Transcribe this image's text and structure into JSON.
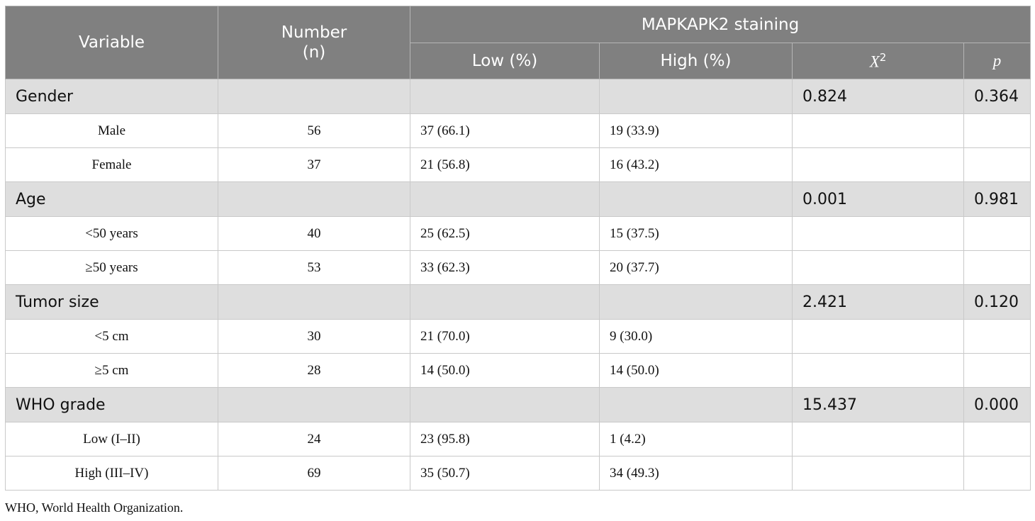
{
  "header": {
    "variable": "Variable",
    "number_line1": "Number",
    "number_line2": "(n)",
    "group": "MAPKAPK2 staining",
    "low": "Low (%)",
    "high": "High (%)",
    "chi_base": "X",
    "chi_sup": "2",
    "p": "p"
  },
  "sections": [
    {
      "label": "Gender",
      "chi2": "0.824",
      "p": "0.364",
      "rows": [
        {
          "cat": "Male",
          "n": "56",
          "low": "37 (66.1)",
          "high": "19 (33.9)"
        },
        {
          "cat": "Female",
          "n": "37",
          "low": "21 (56.8)",
          "high": "16 (43.2)"
        }
      ]
    },
    {
      "label": "Age",
      "chi2": "0.001",
      "p": "0.981",
      "rows": [
        {
          "cat": "<50 years",
          "n": "40",
          "low": "25 (62.5)",
          "high": "15 (37.5)"
        },
        {
          "cat": "≥50 years",
          "n": "53",
          "low": "33 (62.3)",
          "high": "20 (37.7)"
        }
      ]
    },
    {
      "label": "Tumor size",
      "chi2": "2.421",
      "p": "0.120",
      "rows": [
        {
          "cat": "<5 cm",
          "n": "30",
          "low": "21 (70.0)",
          "high": "9 (30.0)"
        },
        {
          "cat": "≥5 cm",
          "n": "28",
          "low": "14 (50.0)",
          "high": "14 (50.0)"
        }
      ]
    },
    {
      "label": "WHO grade",
      "chi2": "15.437",
      "p": "0.000",
      "rows": [
        {
          "cat": "Low (I–II)",
          "n": "24",
          "low": "23 (95.8)",
          "high": "1 (4.2)"
        },
        {
          "cat": "High (III–IV)",
          "n": "69",
          "low": "35 (50.7)",
          "high": "34 (49.3)"
        }
      ]
    }
  ],
  "footnote": "WHO, World Health Organization."
}
